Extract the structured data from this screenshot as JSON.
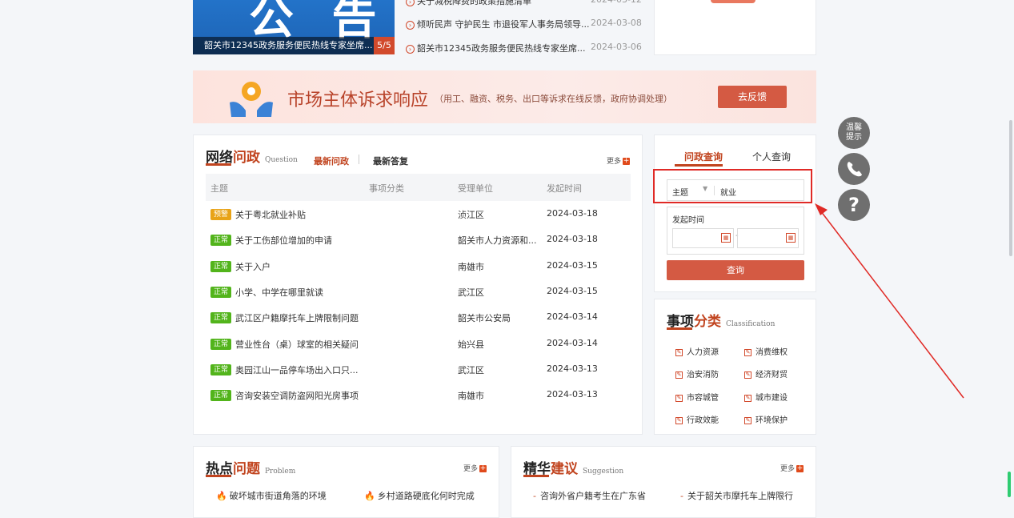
{
  "banner": {
    "big_text": "公 告",
    "caption": "韶关市12345政务服务便民热线专家坐席...",
    "page": "5/5"
  },
  "news": [
    {
      "title": "关于减税降费的政策措施清单",
      "date": "2024-03-12"
    },
    {
      "title": "倾听民声 守护民生 市退役军人事务局领导...",
      "date": "2024-03-08"
    },
    {
      "title": "韶关市12345政务服务便民热线专家坐席...",
      "date": "2024-03-06"
    }
  ],
  "promo": {
    "title": "市场主体诉求响应",
    "subtitle": "（用工、融资、税务、出口等诉求在线反馈，政府协调处理）",
    "button": "去反馈"
  },
  "inquiry": {
    "title_black": "网络",
    "title_red": "问政",
    "title_en": "Question",
    "tab_active": "最新问政",
    "tab_other": "最新答复",
    "more": "更多",
    "headers": [
      "主题",
      "事项分类",
      "受理单位",
      "发起时间"
    ],
    "rows": [
      {
        "tag": "预警",
        "subject": "关于粤北就业补贴",
        "unit": "浈江区",
        "date": "2024-03-18"
      },
      {
        "tag": "正常",
        "subject": "关于工伤部位增加的申请",
        "unit": "韶关市人力资源和...",
        "date": "2024-03-18"
      },
      {
        "tag": "正常",
        "subject": "关于入户",
        "unit": "南雄市",
        "date": "2024-03-15"
      },
      {
        "tag": "正常",
        "subject": "小学、中学在哪里就读",
        "unit": "武江区",
        "date": "2024-03-15"
      },
      {
        "tag": "正常",
        "subject": "武江区户籍摩托车上牌限制问题",
        "unit": "韶关市公安局",
        "date": "2024-03-14"
      },
      {
        "tag": "正常",
        "subject": "营业性台（桌）球室的相关疑问",
        "unit": "始兴县",
        "date": "2024-03-14"
      },
      {
        "tag": "正常",
        "subject": "奥园江山一品停车场出入口只...",
        "unit": "武江区",
        "date": "2024-03-13"
      },
      {
        "tag": "正常",
        "subject": "咨询安装空调防盗网阳光房事项",
        "unit": "南雄市",
        "date": "2024-03-13"
      }
    ],
    "colors": {
      "warn": "#e8a317",
      "normal": "#52b41b"
    }
  },
  "search": {
    "tab_active": "问政查询",
    "tab_other": "个人查询",
    "select_value": "主题",
    "keyword": "就业",
    "date_label": "发起时间",
    "date_sep": "-",
    "button": "查询"
  },
  "classification": {
    "title_black": "事项",
    "title_red": "分类",
    "title_en": "Classification",
    "items": [
      "人力资源",
      "消费维权",
      "治安消防",
      "经济财贸",
      "市容城管",
      "城市建设",
      "行政效能",
      "环境保护"
    ]
  },
  "hot": {
    "title_black": "热点",
    "title_red": "问题",
    "title_en": "Problem",
    "more": "更多",
    "items": [
      "破坏城市街道角落的环境",
      "乡村道路硬底化何时完成"
    ]
  },
  "suggest": {
    "title_black": "精华",
    "title_red": "建议",
    "title_en": "Suggestion",
    "more": "更多",
    "items": [
      "咨询外省户籍考生在广东省",
      "关于韶关市摩托车上牌限行"
    ]
  },
  "floats": {
    "tip": "温馨\n提示",
    "phone": "phone-icon",
    "help": "?"
  },
  "accent": "#c1441f"
}
